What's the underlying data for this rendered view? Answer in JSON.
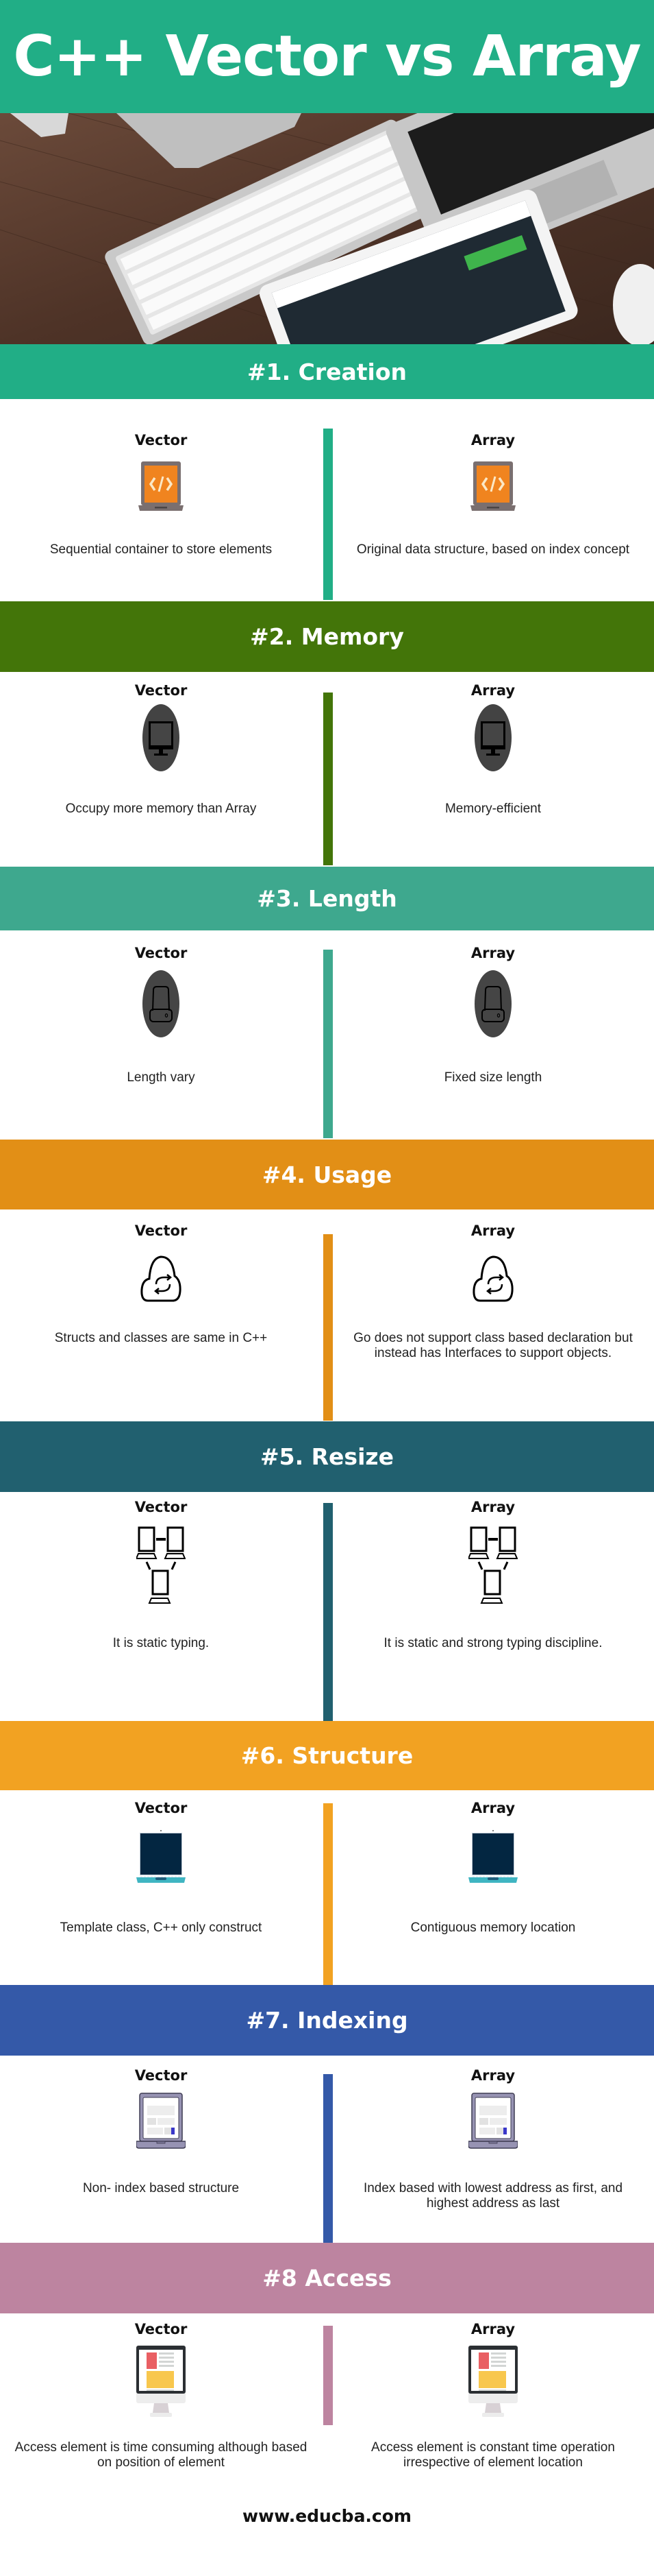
{
  "title": "C++ Vector vs Array",
  "footer": "www.educba.com",
  "photo_alt": "desk with keyboard, laptop, tablet and mouse",
  "column_labels": {
    "left": "Vector",
    "right": "Array"
  },
  "sections": [
    {
      "heading": "#1. Creation",
      "color": "#21ae86",
      "icon": "code-laptop-icon",
      "left": "Sequential container to store elements",
      "right": "Original data structure, based on index concept"
    },
    {
      "heading": "#2. Memory",
      "color": "#437509",
      "icon": "monitor-icon",
      "left": "Occupy more memory than Array",
      "right": "Memory-efficient"
    },
    {
      "heading": "#3. Length",
      "color": "#3ea88e",
      "icon": "hard-drive-icon",
      "left": "Length vary",
      "right": "Fixed size length"
    },
    {
      "heading": "#4. Usage",
      "color": "#e28f16",
      "icon": "cloud-sync-icon",
      "left": "Structs and classes are same in C++",
      "right": "Go does not support class based declaration but instead has Interfaces to support objects."
    },
    {
      "heading": "#5. Resize",
      "color": "#21606f",
      "icon": "network-computers-icon",
      "left": "It is static typing.",
      "right": "It is static and strong typing discipline."
    },
    {
      "heading": "#6. Structure",
      "color": "#f2a222",
      "icon": "laptop-icon",
      "left": "Template class, C++ only construct",
      "right": "Contiguous memory location"
    },
    {
      "heading": "#7. Indexing",
      "color": "#3459a8",
      "icon": "laptop-webpage-icon",
      "left": "Non- index based structure",
      "right": "Index based with lowest address as first, and highest address as last"
    },
    {
      "heading": "#8 Access",
      "color": "#bd84a0",
      "icon": "desktop-computer-icon",
      "left": "Access element is time consuming although based on position of element",
      "right": "Access element is constant time operation irrespective of element location"
    }
  ]
}
